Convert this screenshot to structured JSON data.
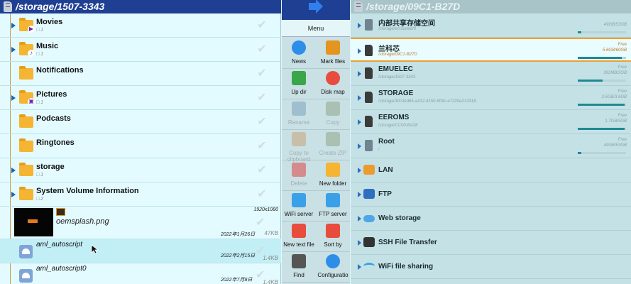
{
  "left_pane": {
    "path": "/storage/1507-3343",
    "folders": [
      {
        "name": "Movies",
        "count": "1",
        "expandable": true,
        "badge": "play"
      },
      {
        "name": "Music",
        "count": "1",
        "expandable": true,
        "badge": "music"
      },
      {
        "name": "Notifications",
        "count": "",
        "expandable": false,
        "badge": ""
      },
      {
        "name": "Pictures",
        "count": "1",
        "expandable": true,
        "badge": "image"
      },
      {
        "name": "Podcasts",
        "count": "",
        "expandable": false,
        "badge": ""
      },
      {
        "name": "Ringtones",
        "count": "",
        "expandable": false,
        "badge": ""
      },
      {
        "name": "storage",
        "count": "1",
        "expandable": true,
        "badge": ""
      },
      {
        "name": "System Volume Information",
        "count": "2",
        "expandable": true,
        "badge": ""
      }
    ],
    "files": [
      {
        "name": "oemsplash.png",
        "dimensions": "1920x1080",
        "date": "2022年1月26日",
        "size": "47KB"
      },
      {
        "name": "aml_autoscript",
        "date": "2022年2月15日",
        "size": "1.4KB"
      },
      {
        "name": "aml_autoscript0",
        "date": "2022年7月8日",
        "size": "1.4KB"
      }
    ]
  },
  "toolbar": {
    "menu_label": "Menu",
    "buttons": [
      {
        "label": "News",
        "enabled": true,
        "icon": "info-icon",
        "color": "#2c8ee8"
      },
      {
        "label": "Mark files",
        "enabled": true,
        "icon": "checkmark-icon",
        "color": "#e3951f"
      },
      {
        "label": "Up dir",
        "enabled": true,
        "icon": "up-arrow-icon",
        "color": "#3aa64a"
      },
      {
        "label": "Disk map",
        "enabled": true,
        "icon": "pie-chart-icon",
        "color": "#e74c3c"
      },
      {
        "label": "Rename",
        "enabled": false,
        "icon": "pencil-icon",
        "color": "#9fbfcf"
      },
      {
        "label": "Copy",
        "enabled": false,
        "icon": "copy-icon",
        "color": "#a9c0b2"
      },
      {
        "label": "Copy to clipboard",
        "enabled": false,
        "icon": "clipboard-icon",
        "color": "#c9bfa8"
      },
      {
        "label": "Create ZIP",
        "enabled": false,
        "icon": "zip-icon",
        "color": "#a9c0b2"
      },
      {
        "label": "Delete",
        "enabled": false,
        "icon": "trash-icon",
        "color": "#d58b8b"
      },
      {
        "label": "New folder",
        "enabled": true,
        "icon": "new-folder-icon",
        "color": "#f5b431"
      },
      {
        "label": "WiFi server",
        "enabled": true,
        "icon": "wifi-server-icon",
        "color": "#3aa0e8"
      },
      {
        "label": "FTP server",
        "enabled": true,
        "icon": "ftp-server-icon",
        "color": "#3aa0e8"
      },
      {
        "label": "New text file",
        "enabled": true,
        "icon": "new-text-file-icon",
        "color": "#e74c3c"
      },
      {
        "label": "Sort by",
        "enabled": true,
        "icon": "sort-icon",
        "color": "#e74c3c"
      },
      {
        "label": "Find",
        "enabled": true,
        "icon": "magnifier-icon",
        "color": "#555555"
      },
      {
        "label": "Configuratio",
        "enabled": true,
        "icon": "gear-icon",
        "color": "#2c8ee8"
      }
    ]
  },
  "right_pane": {
    "path": "/storage/09C1-B27D",
    "devices": [
      {
        "name": "内部共享存储空间",
        "sub": "/storage/emulated/0",
        "free_label": "",
        "capacity": "49GB/53GB",
        "used_fraction": 0.08,
        "icon": "phone"
      },
      {
        "name": "兰科芯",
        "sub": "/storage/09C1-B27D",
        "free_label": "Free",
        "capacity": "5.6GB/60GB",
        "used_fraction": 0.91,
        "icon": "sd",
        "selected": true
      },
      {
        "name": "EMUELEC",
        "sub": "/storage/1507-3343",
        "free_label": "Free",
        "capacity": "992MB/2GB",
        "used_fraction": 0.52,
        "icon": "sd"
      },
      {
        "name": "STORAGE",
        "sub": "/storage/30c3ed65-a412-4150-809c-e7220e213318",
        "free_label": "Free",
        "capacity": "3.5GB/3.6GB",
        "used_fraction": 0.97,
        "icon": "sd"
      },
      {
        "name": "EEROMS",
        "sub": "/storage/CC00-BA28",
        "free_label": "Free",
        "capacity": "1.7GB/5GB",
        "used_fraction": 0.97,
        "icon": "sd"
      },
      {
        "name": "Root",
        "sub": "/",
        "free_label": "Free",
        "capacity": "49GB/53GB",
        "used_fraction": 0.08,
        "icon": "phone"
      }
    ],
    "network": [
      {
        "name": "LAN",
        "icon": "lan"
      },
      {
        "name": "FTP",
        "icon": "ftp"
      },
      {
        "name": "Web storage",
        "icon": "cloud"
      },
      {
        "name": "SSH File Transfer",
        "icon": "ssh"
      },
      {
        "name": "WiFi file sharing",
        "icon": "wifi"
      }
    ]
  }
}
